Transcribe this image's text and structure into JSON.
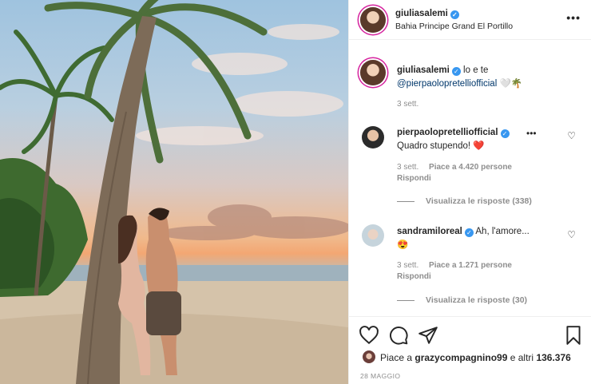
{
  "post": {
    "username": "giuliasalemi",
    "location": "Bahia Principe Grand El Portillo",
    "more_icon": "more-horizontal-icon"
  },
  "caption": {
    "username": "giuliasalemi",
    "text": "lo e te",
    "mention": "@pierpaolopretelliofficial",
    "emoji": "🤍🌴",
    "time": "3 sett."
  },
  "comments": [
    {
      "username": "pierpaolopretelliofficial",
      "text": "Quadro stupendo!",
      "emoji": "❤️",
      "time": "3 sett.",
      "likes": "Piace a 4.420 persone",
      "reply": "Rispondi",
      "view_replies": "Visualizza le risposte (338)"
    },
    {
      "username": "sandramiloreal",
      "text": "Ah, l'amore...",
      "emoji": "😍",
      "time": "3 sett.",
      "likes": "Piace a 1.271 persone",
      "reply": "Rispondi",
      "view_replies": "Visualizza le risposte (30)"
    }
  ],
  "actions": {
    "like_icon": "heart-icon",
    "comment_icon": "comment-icon",
    "share_icon": "share-icon",
    "save_icon": "bookmark-icon"
  },
  "likes": {
    "prefix": "Piace a",
    "user": "grazycompagnino99",
    "middle": "e altri",
    "count": "136.376"
  },
  "date": "28 MAGGIO",
  "colors": {
    "verified": "#3897f0",
    "mention": "#00376b",
    "secondary_text": "#8e8e8e",
    "heart_red": "#ed4956"
  }
}
